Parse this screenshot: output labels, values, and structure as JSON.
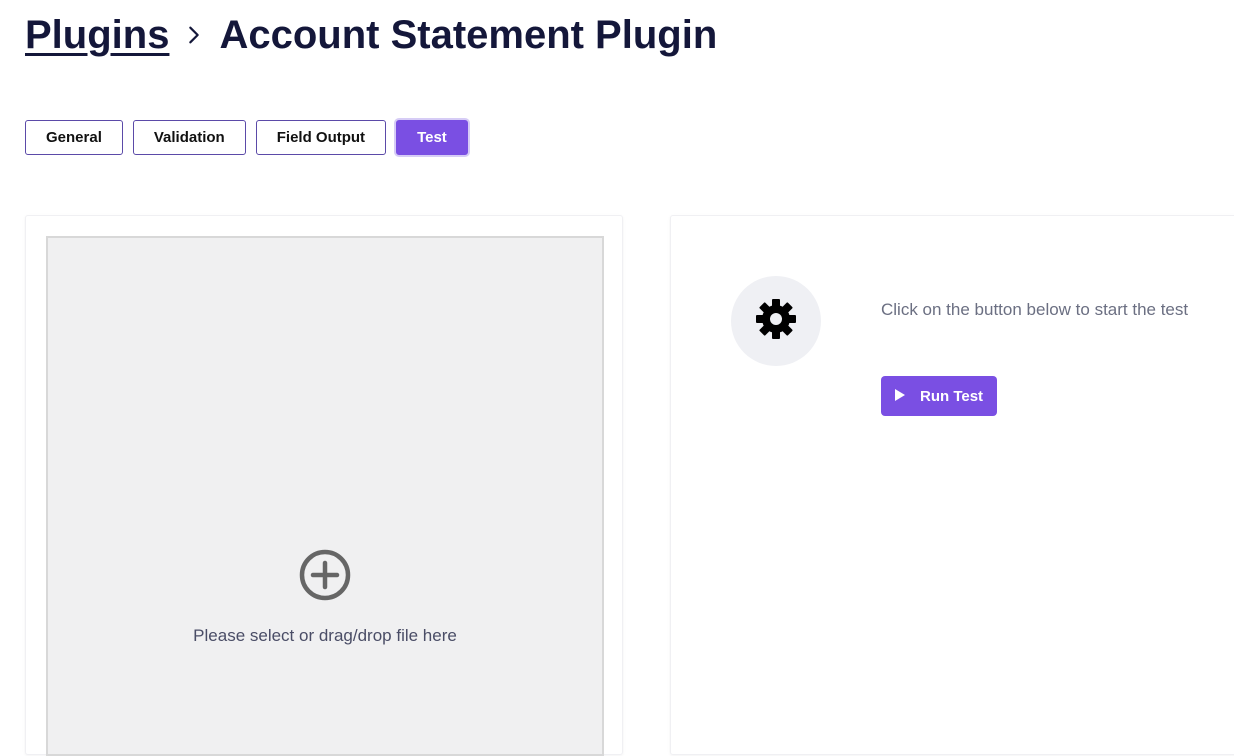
{
  "breadcrumb": {
    "parent_label": "Plugins",
    "current_label": "Account Statement Plugin"
  },
  "tabs": [
    {
      "label": "General",
      "active": false
    },
    {
      "label": "Validation",
      "active": false
    },
    {
      "label": "Field Output",
      "active": false
    },
    {
      "label": "Test",
      "active": true
    }
  ],
  "upload": {
    "prompt": "Please select or drag/drop file here",
    "icon": "plus-circle-icon"
  },
  "test_panel": {
    "icon": "gear-icon",
    "instruction": "Click on the button below to start the test",
    "run_button_label": "Run Test",
    "run_button_icon": "play-icon"
  },
  "colors": {
    "accent": "#7a4fe3",
    "title": "#14173a",
    "tab_border": "#5b4aa8",
    "dropzone_bg": "#f0f0f1"
  }
}
